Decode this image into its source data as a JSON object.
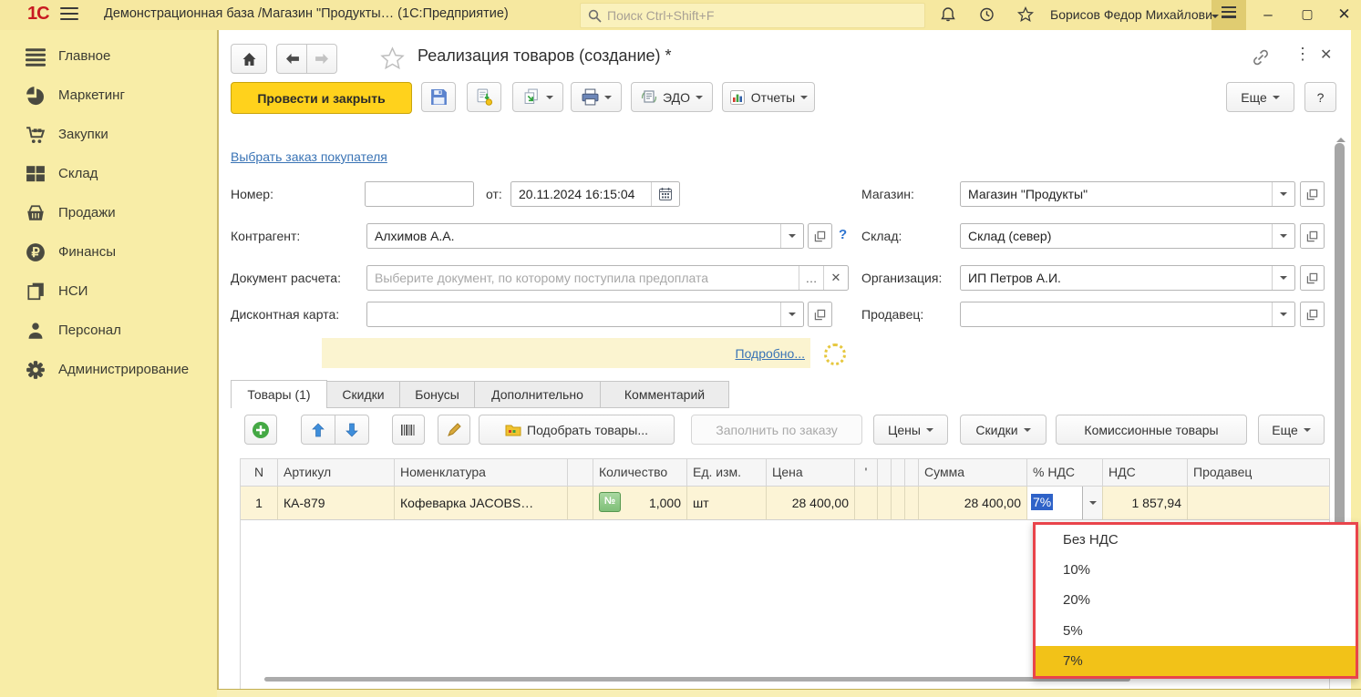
{
  "titlebar": {
    "logo": "1С",
    "app_title": "Демонстрационная база /Магазин \"Продукты…",
    "app_suffix": "(1С:Предприятие)",
    "search_placeholder": "Поиск Ctrl+Shift+F",
    "user_name": "Борисов Федор Михайлович"
  },
  "sidebar": {
    "items": [
      {
        "label": "Главное"
      },
      {
        "label": "Маркетинг"
      },
      {
        "label": "Закупки"
      },
      {
        "label": "Склад"
      },
      {
        "label": "Продажи"
      },
      {
        "label": "Финансы"
      },
      {
        "label": "НСИ"
      },
      {
        "label": "Персонал"
      },
      {
        "label": "Администрирование"
      }
    ]
  },
  "form": {
    "title": "Реализация товаров (создание) *",
    "toolbar": {
      "post_close": "Провести и закрыть",
      "edo": "ЭДО",
      "reports": "Отчеты",
      "more": "Еще",
      "help": "?"
    },
    "select_order_link": "Выбрать заказ покупателя",
    "fields": {
      "number_label": "Номер:",
      "number_value": "",
      "date_label": "от:",
      "date_value": "20.11.2024 16:15:04",
      "counterparty_label": "Контрагент:",
      "counterparty_value": "Алхимов А.А.",
      "settlement_label": "Документ расчета:",
      "settlement_placeholder": "Выберите документ, по которому поступила предоплата",
      "discount_card_label": "Дисконтная карта:",
      "discount_card_value": "",
      "store_label": "Магазин:",
      "store_value": "Магазин \"Продукты\"",
      "warehouse_label": "Склад:",
      "warehouse_value": "Склад (север)",
      "organization_label": "Организация:",
      "organization_value": "ИП Петров А.И.",
      "seller_label": "Продавец:",
      "seller_value": ""
    },
    "details_link": "Подробно...",
    "tabs": [
      "Товары (1)",
      "Скидки",
      "Бонусы",
      "Дополнительно",
      "Комментарий"
    ],
    "table_toolbar": {
      "pick_goods": "Подобрать товары...",
      "fill_by_order": "Заполнить по заказу",
      "prices": "Цены",
      "discounts": "Скидки",
      "commission_goods": "Комиссионные товары",
      "more": "Еще"
    },
    "table": {
      "headers": [
        "N",
        "Артикул",
        "Номенклатура",
        "",
        "Количество",
        "Ед. изм.",
        "Цена",
        "'",
        "",
        "",
        "",
        "Сумма",
        "% НДС",
        "НДС",
        "Продавец"
      ],
      "row": {
        "n": "1",
        "article": "КА-879",
        "nomenclature": "Кофеварка JACOBS…",
        "qty": "1,000",
        "unit": "шт",
        "price": "28 400,00",
        "sum": "28 400,00",
        "vat_percent": "7%",
        "vat": "1 857,94",
        "seller": ""
      }
    },
    "vat_dropdown": {
      "options": [
        "Без НДС",
        "10%",
        "20%",
        "5%",
        "7%"
      ],
      "selected": "7%"
    }
  },
  "colors": {
    "titlebar_bg": "#F6E8A0",
    "sidebar_bg": "#F8EDA7",
    "post_button": "#FFD21C",
    "row_yellow": "#FCF4D6",
    "selection_blue": "#2E62C8",
    "vat_selected": "#F2C218",
    "dropdown_border": "#E9444B"
  }
}
